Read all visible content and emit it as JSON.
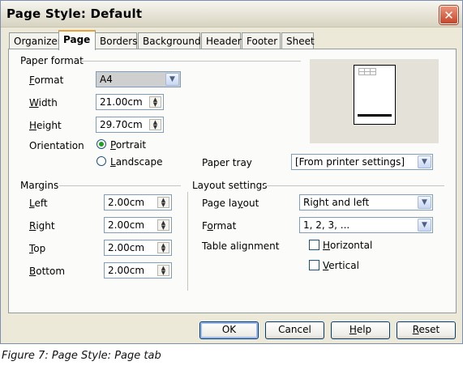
{
  "window": {
    "title": "Page Style: Default",
    "close_icon": "close-icon"
  },
  "tabs": [
    {
      "label": "Organizer",
      "active": false
    },
    {
      "label": "Page",
      "active": true
    },
    {
      "label": "Borders",
      "active": false
    },
    {
      "label": "Background",
      "active": false
    },
    {
      "label": "Header",
      "active": false
    },
    {
      "label": "Footer",
      "active": false
    },
    {
      "label": "Sheet",
      "active": false
    }
  ],
  "paper_format": {
    "heading": "Paper format",
    "format_label_u": "F",
    "format_label_rest": "ormat",
    "format_value": "A4",
    "width_label_u": "W",
    "width_label_rest": "idth",
    "width_value": "21.00cm",
    "height_label_u": "H",
    "height_label_rest": "eight",
    "height_value": "29.70cm",
    "orientation_label": "Orientation",
    "portrait_label_u": "P",
    "portrait_label_rest": "ortrait",
    "landscape_label_u": "L",
    "landscape_label_rest": "andscape",
    "orientation_selected": "Portrait",
    "paper_tray_label": "Paper tray",
    "paper_tray_value": "[From printer settings]"
  },
  "margins": {
    "heading": "Margins",
    "left_label_u": "L",
    "left_label_rest": "eft",
    "left_value": "2.00cm",
    "right_label_u": "R",
    "right_label_rest": "ight",
    "right_value": "2.00cm",
    "top_label_u": "T",
    "top_label_rest": "op",
    "top_value": "2.00cm",
    "bottom_label_u": "B",
    "bottom_label_rest": "ottom",
    "bottom_value": "2.00cm"
  },
  "layout_settings": {
    "heading": "Layout settings",
    "page_layout_label_a": "Page la",
    "page_layout_label_u": "y",
    "page_layout_label_b": "out",
    "page_layout_value": "Right and left",
    "format_label_a": "F",
    "format_label_u": "o",
    "format_label_b": "rmat",
    "format_value": "1, 2, 3, ...",
    "table_alignment_label": "Table alignment",
    "horizontal_label_u": "H",
    "horizontal_label_rest": "orizontal",
    "horizontal_checked": false,
    "vertical_label_u": "V",
    "vertical_label_rest": "ertical",
    "vertical_checked": false
  },
  "buttons": {
    "ok": "OK",
    "cancel": "Cancel",
    "help_u": "H",
    "help_rest": "elp",
    "reset_u": "R",
    "reset_rest": "eset"
  },
  "caption": "Figure 7: Page Style: Page tab"
}
